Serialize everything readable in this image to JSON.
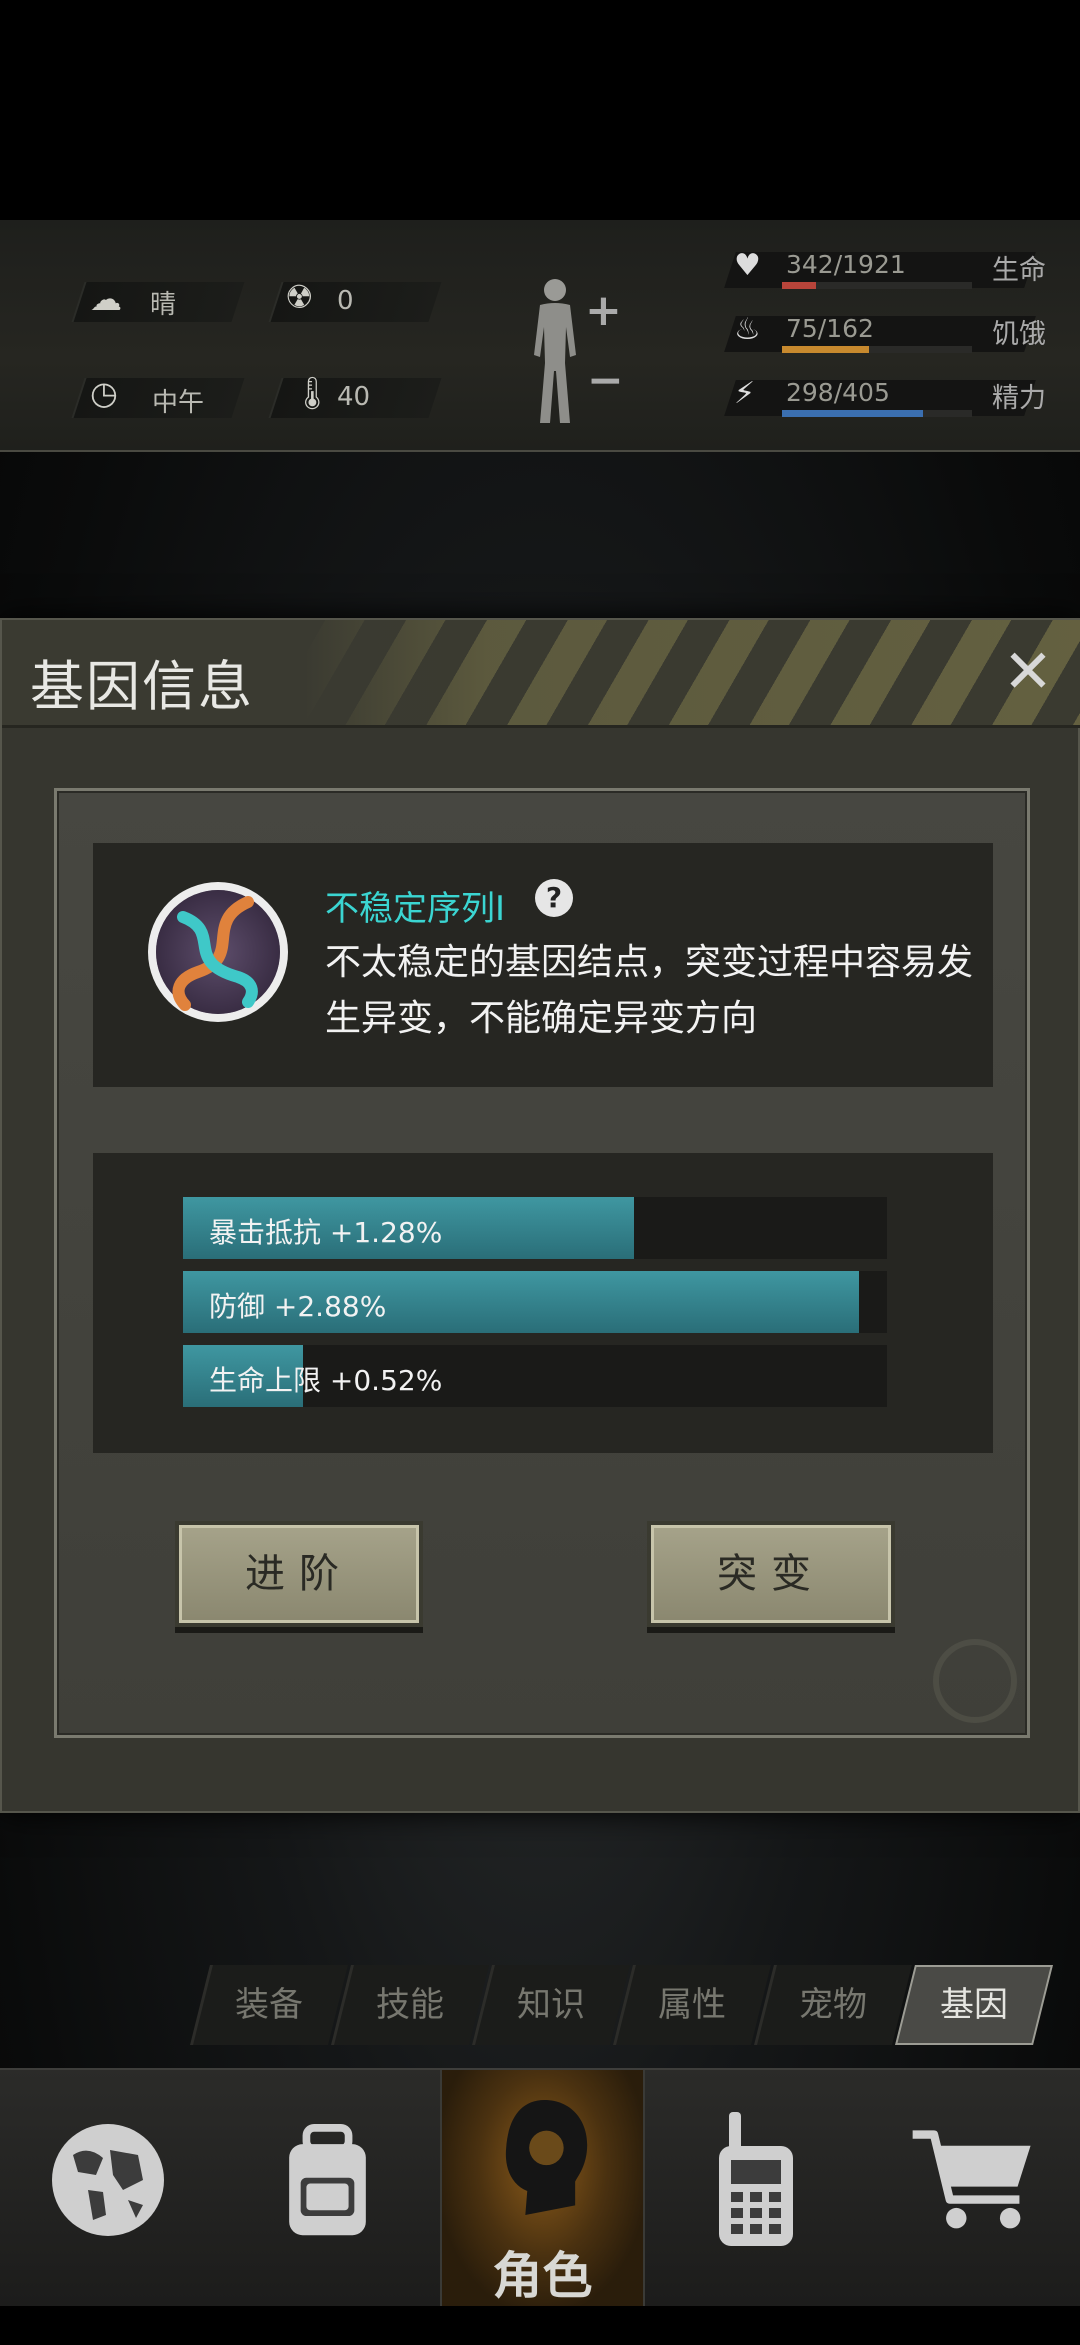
{
  "status": {
    "weather": {
      "icon": "partly-cloudy-icon",
      "label": "晴"
    },
    "radiation": {
      "icon": "radiation-icon",
      "value": "0"
    },
    "time": {
      "icon": "clock-icon",
      "label": "中午"
    },
    "temperature": {
      "icon": "thermometer-icon",
      "value": "40"
    },
    "vitals": [
      {
        "icon": "heart-icon",
        "value": "342/1921",
        "name": "生命",
        "fraction": 0.18,
        "color": "#b8443a"
      },
      {
        "icon": "stomach-icon",
        "value": "75/162",
        "name": "饥饿",
        "fraction": 0.46,
        "color": "#c7892e"
      },
      {
        "icon": "energy-icon",
        "value": "298/405",
        "name": "精力",
        "fraction": 0.74,
        "color": "#3b6fb0"
      }
    ]
  },
  "dialog": {
    "title": "基因信息",
    "gene": {
      "name": "不稳定序列Ⅰ",
      "help": "?",
      "description": "不太稳定的基因结点，突变过程中容易发生异变，不能确定异变方向"
    },
    "stats": [
      {
        "label": "暴击抵抗 +1.28%",
        "fraction": 0.64
      },
      {
        "label": "防御 +2.88%",
        "fraction": 0.96
      },
      {
        "label": "生命上限 +0.52%",
        "fraction": 0.17
      }
    ],
    "buttons": {
      "advance": "进阶",
      "mutate": "突变"
    }
  },
  "tabs": [
    "装备",
    "技能",
    "知识",
    "属性",
    "宠物",
    "基因"
  ],
  "active_tab": "基因",
  "nav": {
    "items": [
      {
        "icon": "globe-icon"
      },
      {
        "icon": "backpack-icon"
      },
      {
        "icon": "character-head-icon",
        "label": "角色"
      },
      {
        "icon": "walkie-talkie-icon"
      },
      {
        "icon": "shopping-cart-icon"
      }
    ]
  }
}
